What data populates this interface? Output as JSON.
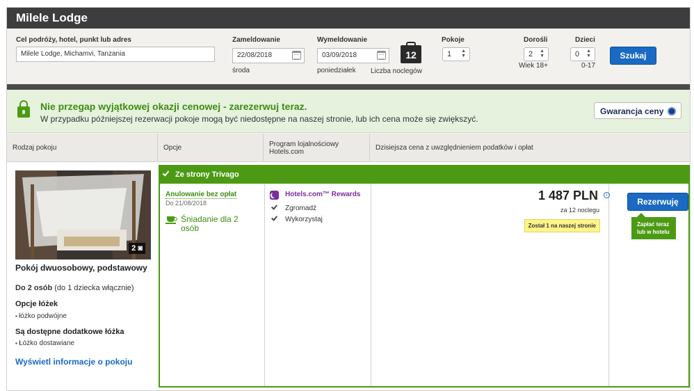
{
  "hotel_name": "Milele Lodge",
  "search": {
    "destination_label": "Cel podróży, hotel, punkt lub adres",
    "destination_value": "Milele Lodge, Michamvi, Tanzania",
    "checkin_label": "Zameldowanie",
    "checkin_value": "22/08/2018",
    "checkin_day": "środa",
    "checkout_label": "Wymeldowanie",
    "checkout_value": "03/09/2018",
    "checkout_day": "poniedziałek",
    "nights_count": "12",
    "nights_label": "Liczba noclegów",
    "rooms_label": "Pokoje",
    "rooms_value": "1",
    "adults_label": "Dorośli",
    "adults_value": "2",
    "adults_hint": "Wiek 18+",
    "children_label": "Dzieci",
    "children_value": "0",
    "children_hint": "0-17",
    "search_button": "Szukaj"
  },
  "banner": {
    "title": "Nie przegap wyjątkowej okazji cenowej - zarezerwuj teraz.",
    "text": "W przypadku późniejszej rezerwacji pokoje mogą być niedostępne na naszej stronie, lub ich cena może się zwiększyć.",
    "guarantee_button": "Gwarancja ceny"
  },
  "table_headers": {
    "room_type": "Rodzaj pokoju",
    "options": "Opcje",
    "loyalty": "Program lojalnościowy Hotels.com",
    "price": "Dzisiejsza cena z uwzględnieniem podatków i opłat"
  },
  "room": {
    "photo_count": "2",
    "name": "Pokój dwuosobowy, podstawowy",
    "occupancy_bold": "Do 2 osób",
    "occupancy_rest": "(do 1 dziecka włącznie)",
    "beds_heading": "Opcje łóżek",
    "beds_item": "łóżko podwójne",
    "extra_heading": "Są dostępne dodatkowe łóżka",
    "extra_item": "Łóżko dostawiane",
    "info_link": "Wyświetl informacje o pokoju"
  },
  "offer": {
    "source": "Ze strony Trivago",
    "cancellation": "Anulowanie bez opłat",
    "cancellation_date": "Do 21/08/2018",
    "breakfast": "Śniadanie dla 2 osób",
    "rewards": "Hotels.com™ Rewards",
    "collect": "Zgromadź",
    "redeem": "Wykorzystaj",
    "price": "1 487 PLN",
    "price_info": "i",
    "per_nights": "za 12 noclegu",
    "last_room": "Został 1 na naszej stronie",
    "book_button": "Rezerwuję",
    "pay_note": "Zapłać teraz lub w hotelu"
  },
  "colors": {
    "green": "#4c9a14",
    "blue": "#1a6ac3",
    "purple": "#7b2c9e",
    "header": "#3d3d3d"
  }
}
